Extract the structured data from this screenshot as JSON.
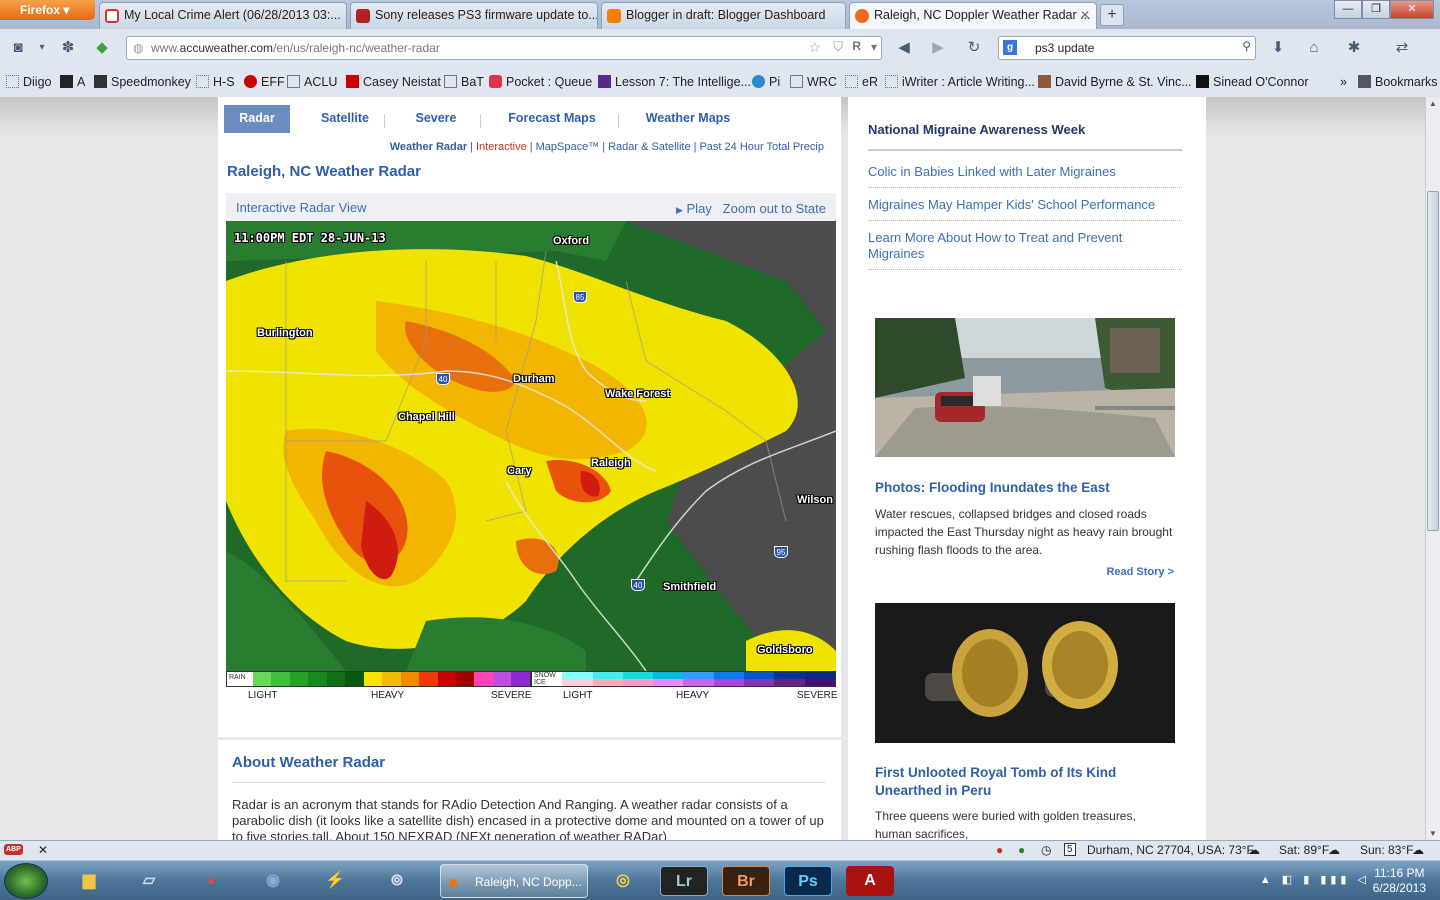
{
  "browser": {
    "app_button": "Firefox",
    "tabs": [
      {
        "label": "My Local Crime Alert (06/28/2013 03:...",
        "favicon_color": "#d93025"
      },
      {
        "label": "Sony releases PS3 firmware update to...",
        "favicon_color": "#b3201e"
      },
      {
        "label": "Blogger in draft: Blogger Dashboard",
        "favicon_color": "#f57d00"
      },
      {
        "label": "Raleigh, NC Doppler Weather Radar ...",
        "favicon_color": "#f26b1d"
      }
    ],
    "url_prefix": "www.",
    "url_domain": "accuweather.com",
    "url_path": "/en/us/raleigh-nc/weather-radar",
    "search_query": "ps3 update",
    "bookmarks": [
      "Diigo",
      "A",
      "Speedmonkey",
      "H-S",
      "EFF",
      "ACLU",
      "Casey Neistat",
      "BaT",
      "Pocket : Queue",
      "Lesson 7: The Intellige...",
      "Pi",
      "WRC",
      "eR",
      "iWriter : Article Writing...",
      "David Byrne & St. Vinc...",
      "Sinead O'Connor"
    ],
    "bookmarks_menu": "Bookmarks",
    "chevron": "»"
  },
  "page": {
    "tabs": [
      "Radar",
      "Satellite",
      "Severe",
      "Forecast Maps",
      "Weather Maps"
    ],
    "sublinks": {
      "current": "Weather Radar",
      "red": "Interactive",
      "rest": [
        "MapSpace™",
        "Radar & Satellite",
        "Past 24 Hour Total Precip"
      ]
    },
    "title": "Raleigh, NC Weather Radar",
    "radar_view_label": "Interactive Radar View",
    "play": "Play",
    "zoom_out": "Zoom out to State",
    "timestamp": "11:00PM EDT 28-JUN-13",
    "cities": [
      "Oxford",
      "Burlington",
      "Durham",
      "Wake Forest",
      "Chapel Hill",
      "Cary",
      "Raleigh",
      "Wilson",
      "Smithfield",
      "Goldsboro"
    ],
    "highways": [
      "85",
      "40",
      "95",
      "40"
    ],
    "legend": {
      "rain_tag": "RAIN",
      "snow_tag_1": "SNOW",
      "snow_tag_2": "ICE",
      "rain_labels": [
        "LIGHT",
        "HEAVY",
        "SEVERE"
      ],
      "snow_labels": [
        "LIGHT",
        "HEAVY",
        "SEVERE"
      ],
      "rain_colors": [
        "#66d85a",
        "#3fbf3c",
        "#26a226",
        "#168a1c",
        "#0f6e16",
        "#0a5810",
        "#f4e400",
        "#f3bb00",
        "#f08a00",
        "#ea3b00",
        "#c90000",
        "#9e0000",
        "#ff44b4",
        "#c04ce0",
        "#8a2ad0"
      ],
      "snow_colors": [
        "#8ff",
        "#4ee",
        "#1dd",
        "#0bd",
        "#39f",
        "#17e",
        "#05c",
        "#039",
        "#0a2a8a"
      ],
      "ice_colors": [
        "#fcd",
        "#fab",
        "#f9c",
        "#e8f",
        "#c6e",
        "#a4d",
        "#83b",
        "#628",
        "#417"
      ]
    },
    "about": {
      "title": "About Weather Radar",
      "body": "Radar is an acronym that stands for RAdio Detection And Ranging. A weather radar consists of a parabolic dish (it looks like a satellite dish) encased in a protective dome and mounted on a tower of up to five stories tall. About 150 NEXRAD (NEXt generation of weather RADar)"
    }
  },
  "sidebar": {
    "heading": "National Migraine Awareness Week",
    "links": [
      "Colic in Babies Linked with Later Migraines",
      "Migraines May Hamper Kids' School Performance",
      "Learn More About How to Treat and Prevent Migraines"
    ],
    "story1": {
      "title": "Photos: Flooding Inundates the East",
      "text": "Water rescues, collapsed bridges and closed roads impacted the East Thursday night as heavy rain brought rushing flash floods to the area.",
      "more": "Read Story >"
    },
    "story2": {
      "title": "First Unlooted Royal Tomb of Its Kind Unearthed in Peru",
      "text": "Three queens were buried with golden treasures, human sacrifices,"
    }
  },
  "statusbar": {
    "abp": "ABP",
    "close": "✕",
    "weather_now": "Durham, NC 27704, USA: 73°F",
    "sat": "Sat: 89°F",
    "sun": "Sun: 83°F",
    "calendar_day": "5"
  },
  "taskbar": {
    "active_label": "Raleigh, NC Dopp...",
    "time": "11:16 PM",
    "date": "6/28/2013",
    "apps": [
      "Lr",
      "Br",
      "Ps",
      "A"
    ]
  }
}
